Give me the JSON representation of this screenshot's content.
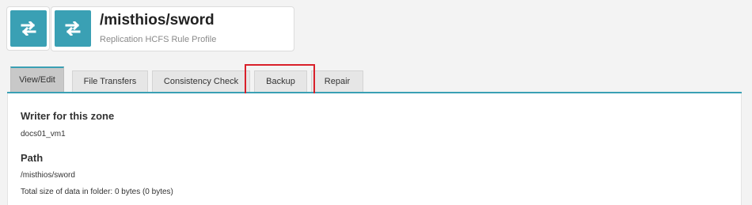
{
  "header": {
    "title": "/misthios/sword",
    "subtitle": "Replication HCFS Rule Profile",
    "icon": "transfer-arrows-icon",
    "accent_color": "#3aa0b4"
  },
  "tabs": [
    {
      "label": "View/Edit",
      "active": true
    },
    {
      "label": "File Transfers",
      "active": false
    },
    {
      "label": "Consistency Check",
      "active": false
    },
    {
      "label": "Backup",
      "active": false,
      "highlighted": true
    },
    {
      "label": "Repair",
      "active": false
    }
  ],
  "content": {
    "writer_heading": "Writer for this zone",
    "writer_value": "docs01_vm1",
    "path_heading": "Path",
    "path_value": "/misthios/sword",
    "total_size": "Total size of data in folder: 0 bytes (0 bytes)"
  },
  "highlight_color": "#d9202a"
}
